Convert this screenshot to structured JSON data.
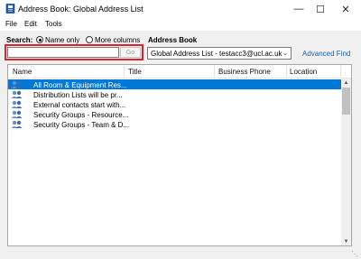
{
  "window": {
    "title": "Address Book: Global Address List",
    "min_glyph": "—",
    "max_glyph": "☐",
    "close_glyph": "✕"
  },
  "menu": {
    "file": "File",
    "edit": "Edit",
    "tools": "Tools"
  },
  "search": {
    "label": "Search:",
    "mode_name_only": "Name only",
    "mode_more_columns": "More columns",
    "selected_mode": "Name only",
    "value": "",
    "go_label": "Go"
  },
  "address_book": {
    "label": "Address Book",
    "selected": "Global Address List - testacc3@ucl.ac.uk",
    "advanced_find": "Advanced Find"
  },
  "list": {
    "columns": [
      "Name",
      "Title",
      "Business Phone",
      "Location"
    ],
    "rows": [
      {
        "name": "All Room & Equipment Res...",
        "selected": true,
        "icon": "group-icon"
      },
      {
        "name": "Distribution Lists will be pr...",
        "selected": false,
        "icon": "group-icon"
      },
      {
        "name": "External contacts start with...",
        "selected": false,
        "icon": "group-icon"
      },
      {
        "name": "Security Groups - Resource...",
        "selected": false,
        "icon": "group-icon"
      },
      {
        "name": "Security Groups - Team & D...",
        "selected": false,
        "icon": "group-icon"
      }
    ]
  },
  "colors": {
    "selection": "#0078d7",
    "highlight_border": "#e0202e",
    "link": "#1a5fb4"
  }
}
